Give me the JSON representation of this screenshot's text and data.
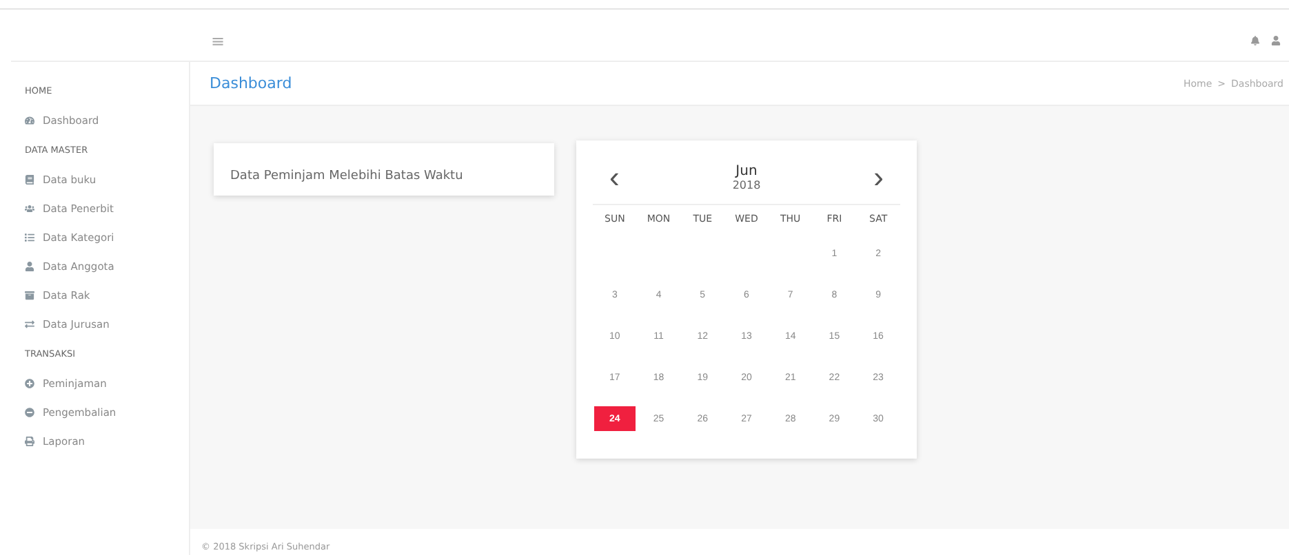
{
  "topbar": {
    "menu_glyph": "≡"
  },
  "sidebar": {
    "items": [
      {
        "kind": "header",
        "label": "HOME"
      },
      {
        "kind": "item",
        "label": "Dashboard"
      },
      {
        "kind": "header",
        "label": "DATA MASTER"
      },
      {
        "kind": "item",
        "label": "Data buku"
      },
      {
        "kind": "item",
        "label": "Data Penerbit"
      },
      {
        "kind": "item",
        "label": "Data Kategori"
      },
      {
        "kind": "item",
        "label": "Data Anggota"
      },
      {
        "kind": "item",
        "label": "Data Rak"
      },
      {
        "kind": "item",
        "label": "Data Jurusan"
      },
      {
        "kind": "header",
        "label": "TRANSAKSI"
      },
      {
        "kind": "item",
        "label": "Peminjaman"
      },
      {
        "kind": "item",
        "label": "Pengembalian"
      },
      {
        "kind": "item",
        "label": "Laporan"
      }
    ]
  },
  "page_header": {
    "title": "Dashboard",
    "breadcrumb": [
      "Home",
      "Dashboard"
    ],
    "separator": ">"
  },
  "card": {
    "title": "Data Peminjam Melebihi Batas Waktu"
  },
  "calendar": {
    "prev": "‹",
    "next": "›",
    "month": "Jun",
    "year": "2018",
    "weekdays": [
      "SUN",
      "MON",
      "TUE",
      "WED",
      "THU",
      "FRI",
      "SAT"
    ],
    "weeks": [
      [
        {
          "label": "1",
          "selected": false
        },
        {
          "label": "2",
          "selected": false
        }
      ],
      [
        {
          "label": "3",
          "selected": false
        },
        {
          "label": "4",
          "selected": false
        },
        {
          "label": "5",
          "selected": false
        },
        {
          "label": "6",
          "selected": false
        },
        {
          "label": "7",
          "selected": false
        },
        {
          "label": "8",
          "selected": false
        },
        {
          "label": "9",
          "selected": false
        }
      ],
      [
        {
          "label": "10",
          "selected": false
        },
        {
          "label": "11",
          "selected": false
        },
        {
          "label": "12",
          "selected": false
        },
        {
          "label": "13",
          "selected": false
        },
        {
          "label": "14",
          "selected": false
        },
        {
          "label": "15",
          "selected": false
        },
        {
          "label": "16",
          "selected": false
        }
      ],
      [
        {
          "label": "17",
          "selected": false
        },
        {
          "label": "18",
          "selected": false
        },
        {
          "label": "19",
          "selected": false
        },
        {
          "label": "20",
          "selected": false
        },
        {
          "label": "21",
          "selected": false
        },
        {
          "label": "22",
          "selected": false
        },
        {
          "label": "23",
          "selected": false
        }
      ],
      [
        {
          "label": "24",
          "selected": true
        },
        {
          "label": "25",
          "selected": false
        },
        {
          "label": "26",
          "selected": false
        },
        {
          "label": "27",
          "selected": false
        },
        {
          "label": "28",
          "selected": false
        },
        {
          "label": "29",
          "selected": false
        },
        {
          "label": "30",
          "selected": false
        }
      ]
    ]
  },
  "footer": {
    "text": "© 2018 Skripsi Ari Suhendar"
  }
}
